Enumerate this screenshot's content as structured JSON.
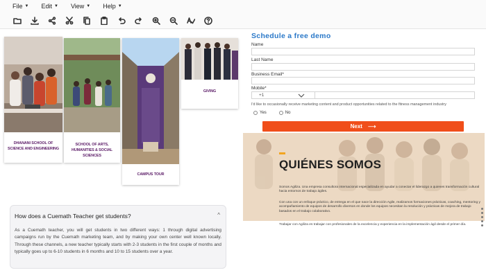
{
  "menu": [
    {
      "label": "File"
    },
    {
      "label": "Edit"
    },
    {
      "label": "View"
    },
    {
      "label": "Help"
    }
  ],
  "toolbar_icons": [
    "open-folder-icon",
    "download-icon",
    "share-icon",
    "cut-icon",
    "copy-icon",
    "paste-icon",
    "undo-icon",
    "redo-icon",
    "zoom-in-icon",
    "zoom-out-icon",
    "spellcheck-icon",
    "help-icon"
  ],
  "cards": [
    {
      "caption": "DHANANI SCHOOL OF SCIENCE AND ENGINEERING"
    },
    {
      "caption": "SCHOOL OF ARTS, HUMANITIES & SOCIAL SCIENCES"
    },
    {
      "caption": "CAMPUS TOUR"
    },
    {
      "caption": "GIVING"
    }
  ],
  "faq": {
    "question": "How does a Cuemath Teacher get students?",
    "toggle": "^",
    "answer": "As a Cuemath teacher, you will get students in two different ways: 1 through digital advertising campaigns run by the Cuemath marketing team, and by making your own center well known locally. Through these channels, a new teacher typically starts with 2-3 students in the first couple of months and typically goes up to 6-10 students in 6 months and 10 to 15 students over a year."
  },
  "form": {
    "title": "Schedule a free demo",
    "name_label": "Name",
    "last_name_label": "Last Name",
    "email_label": "Business Email*",
    "mobile_label": "Mobile*",
    "phone_prefix": "+1",
    "consent": "I'd like to occasionally receive marketing content and product opportunities related to the fitness management industry",
    "yes_label": "Yes",
    "no_label": "No",
    "next_label": "Next",
    "next_arrow": "⟶",
    "accent_color": "#f04e1a",
    "title_color": "#2a78c8"
  },
  "about": {
    "title": "QUIÉNES SOMOS",
    "p1": "Somos Agiliza. Una empresa consultora internacional especializada en ayudar a conectar el liderazgo a quienes transformación cultural hacia entornos de trabajo ágiles.",
    "p2": "Con una con un enfoque práctico, de entrega en el que nace la dirección Agile, realizamos formaciones prácticas, coaching, mentoring y acompañamiento de equipos de desarrollo diversos en donde los equipos necesitan la resolución y prácticas de mejora de trabajo basados en el trabajo colaborativo.",
    "p3": "Trabajar con Agiliza es trabajar con profesionales de la excelencia y experiencia en la implementación ágil desde el primer día.",
    "accent_color": "#f2a520"
  }
}
